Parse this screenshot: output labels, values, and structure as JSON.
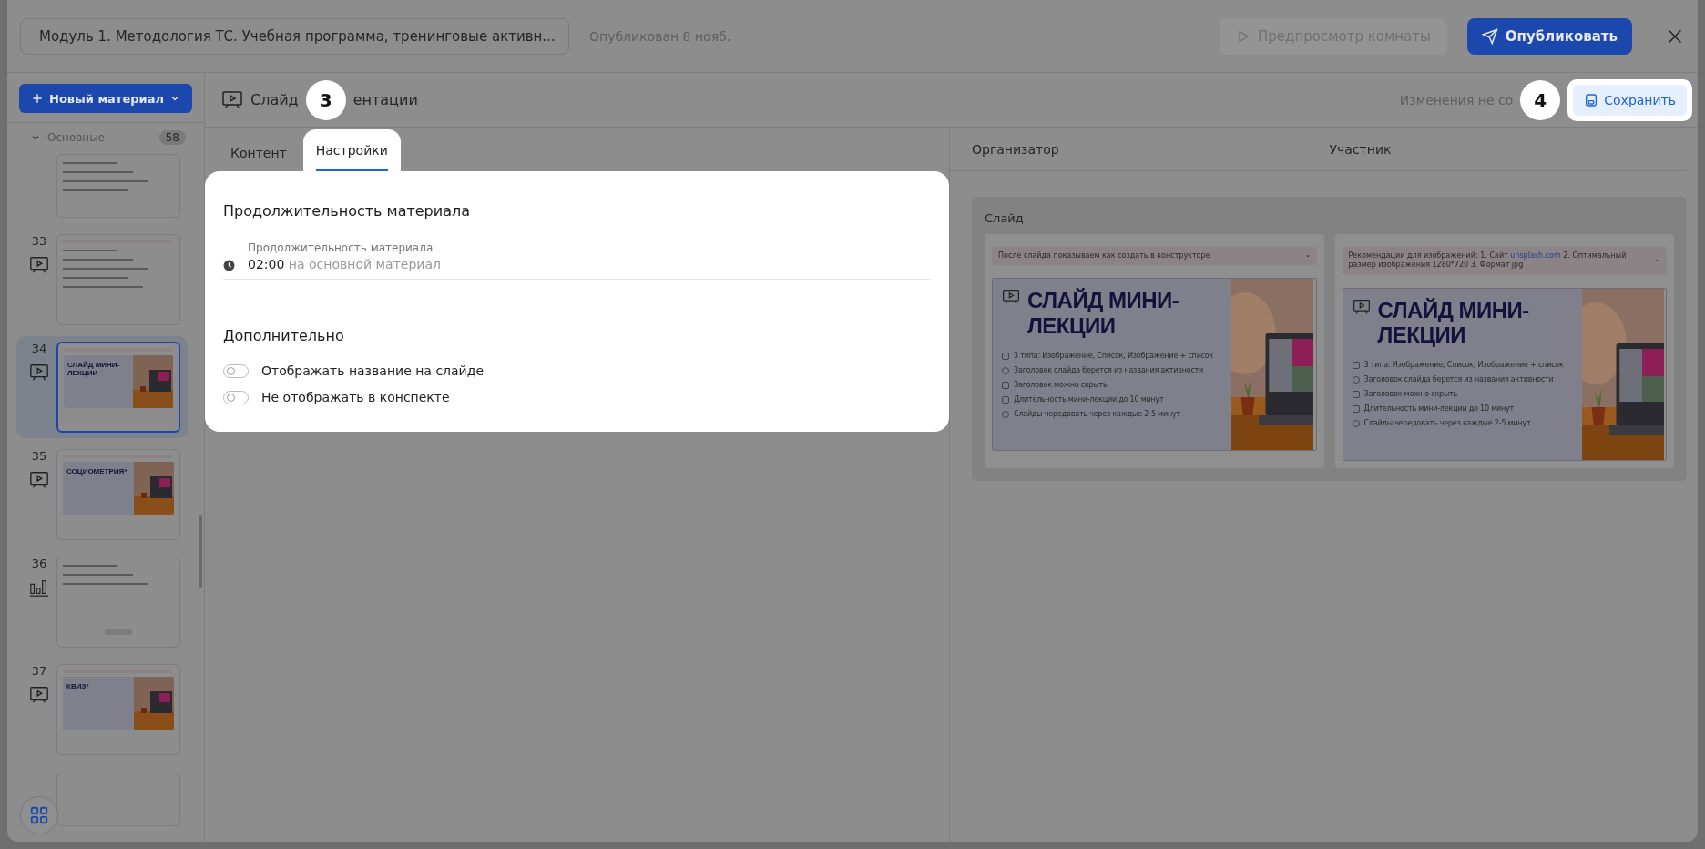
{
  "top_bar": {
    "module_title": "Модуль 1. Методология ТС. Учебная программа, тренинговые активн...",
    "status": "Опубликован 8 нояб.",
    "preview_button": {
      "label": "Предпросмотр комнаты",
      "disabled": true
    },
    "publish_button": "Опубликовать"
  },
  "sidebar": {
    "new_button": "Новый материал",
    "section": {
      "label": "Основные",
      "count": "58",
      "expanded": true
    },
    "slides": [
      {
        "thumb": {
          "kind": "notes"
        },
        "selected": false
      },
      {
        "number": "33",
        "kind": "presentation",
        "thumb": {
          "kind": "notes_slide"
        },
        "selected": false
      },
      {
        "number": "34",
        "kind": "presentation",
        "thumb": {
          "kind": "slide",
          "title": "СЛАЙД МИНИ-ЛЕКЦИИ"
        },
        "selected": true
      },
      {
        "number": "35",
        "kind": "presentation",
        "thumb": {
          "kind": "slide",
          "title": "СОЦИОМЕТРИЯ*"
        },
        "selected": false
      },
      {
        "number": "36",
        "kind": "poll",
        "thumb": {
          "kind": "poll"
        },
        "selected": false
      },
      {
        "number": "37",
        "kind": "presentation",
        "thumb": {
          "kind": "slide",
          "title": "КВИЗ*"
        },
        "selected": false
      },
      {
        "thumb": {
          "kind": "blank"
        },
        "selected": false
      }
    ]
  },
  "header": {
    "title_start": "Слайд",
    "step_badge": "3",
    "title_end": "ентации",
    "save_status": "Изменения не со",
    "save_step_badge": "4",
    "save_button": "Сохранить"
  },
  "tabs": [
    {
      "label": "Контент",
      "selected": false
    },
    {
      "label": "Настройки",
      "selected": true
    }
  ],
  "settings": {
    "duration_section": "Продолжительность материала",
    "duration_field": {
      "label": "Продолжительность материала",
      "value": "02:00",
      "suffix": "на основной материал"
    },
    "extra_section": "Дополнительно",
    "options": [
      {
        "label": "Отображать название на слайде",
        "on": false
      },
      {
        "label": "Не отображать в конспекте",
        "on": false
      }
    ]
  },
  "preview": {
    "columns": [
      "Организатор",
      "Участник"
    ],
    "card_title": "Слайд",
    "panes": [
      {
        "note": "После слайда показываем как создать в конструкторе",
        "slide": {
          "title": "СЛАЙД МИНИ-ЛЕКЦИИ",
          "bullets": [
            {
              "text": "3 типа: Изображение, Список, Изображение + список",
              "kind": "square"
            },
            {
              "text": "Заголовок слайда берется из названия активности",
              "kind": "circle"
            },
            {
              "text": "Заголовок можно скрыть",
              "kind": "square"
            },
            {
              "text": "Длительность мини-лекции до 10 минут",
              "kind": "square"
            },
            {
              "text": "Слайды чередовать через каждые 2-5 минут",
              "kind": "circle"
            }
          ]
        }
      },
      {
        "note": "Рекомендации для изображений: 1. Сайт",
        "note_link": "unsplash.com",
        "note_after": "2. Оптимальный размер изображения 1280*720 3. Формат jpg",
        "slide": {
          "title": "СЛАЙД МИНИ-ЛЕКЦИИ",
          "bullets": [
            {
              "text": "3 типа: Изображение, Список, Изображение + список",
              "kind": "square"
            },
            {
              "text": "Заголовок слайда берется из названия активности",
              "kind": "circle"
            },
            {
              "text": "Заголовок можно скрыть",
              "kind": "square"
            },
            {
              "text": "Длительность мини-лекции до 10 минут",
              "kind": "square"
            },
            {
              "text": "Слайды чередовать через каждые 2-5 минут",
              "kind": "circle"
            }
          ]
        }
      }
    ]
  }
}
